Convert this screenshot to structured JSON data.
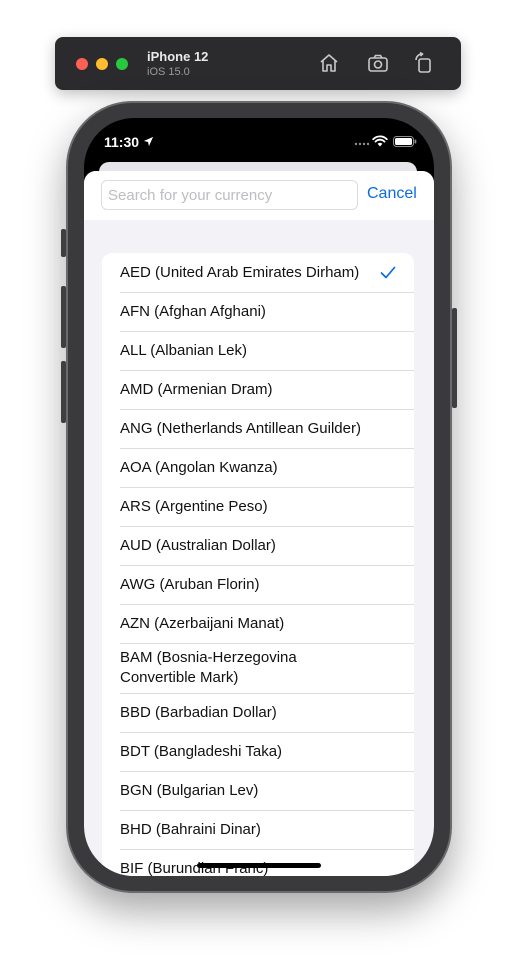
{
  "simulator": {
    "device_name": "iPhone 12",
    "os_version": "iOS 15.0",
    "icons": [
      "home-icon",
      "screenshot-icon",
      "rotate-icon"
    ]
  },
  "status_bar": {
    "time": "11:30",
    "icons": [
      "location-arrow-icon",
      "signal-icon",
      "wifi-icon",
      "battery-icon"
    ]
  },
  "search": {
    "placeholder": "Search for your currency",
    "value": "",
    "cancel_label": "Cancel"
  },
  "currencies": [
    {
      "label": "AED (United Arab Emirates Dirham)",
      "selected": true
    },
    {
      "label": "AFN (Afghan Afghani)"
    },
    {
      "label": "ALL (Albanian Lek)"
    },
    {
      "label": "AMD (Armenian Dram)"
    },
    {
      "label": "ANG (Netherlands Antillean Guilder)"
    },
    {
      "label": "AOA (Angolan Kwanza)"
    },
    {
      "label": "ARS (Argentine Peso)"
    },
    {
      "label": "AUD (Australian Dollar)"
    },
    {
      "label": "AWG (Aruban Florin)"
    },
    {
      "label": "AZN (Azerbaijani Manat)"
    },
    {
      "label": "BAM (Bosnia-Herzegovina Convertible Mark)"
    },
    {
      "label": "BBD (Barbadian Dollar)"
    },
    {
      "label": "BDT (Bangladeshi Taka)"
    },
    {
      "label": "BGN (Bulgarian Lev)"
    },
    {
      "label": "BHD (Bahraini Dinar)"
    },
    {
      "label": "BIF (Burundian Franc)"
    }
  ],
  "colors": {
    "accent": "#0a6cdf",
    "sheet_background": "#f2f2f7",
    "separator": "#dedee2"
  }
}
